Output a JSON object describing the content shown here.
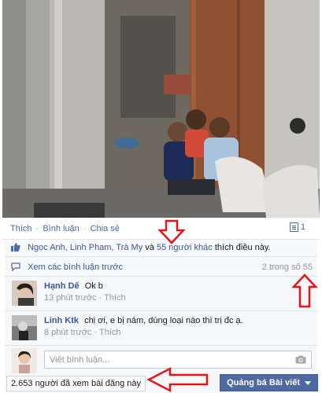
{
  "post": {
    "photo_alt": "",
    "actions": {
      "like": "Thích",
      "comment": "Bình luận",
      "share": "Chia sẻ",
      "separator": "·"
    },
    "share_count": "1"
  },
  "likes": {
    "names": "Ngọc Anh, Linh Pham, Trà My",
    "and": "và",
    "others": "55 người khác",
    "suffix": "thích điều này."
  },
  "previous_comments": {
    "label": "Xem các bình luận trước",
    "pager": "2 trong số 55"
  },
  "comments": [
    {
      "author": "Hạnh Dế",
      "text": "Ok b",
      "time": "13 phút trước",
      "like": "Thích"
    },
    {
      "author": "Linh Ktk",
      "text": "chị ơi, e bị nám, dùng loại nào thì trị đc ạ.",
      "time": "8 phút trước",
      "like": "Thích"
    }
  ],
  "composer": {
    "placeholder": "Viết bình luận..."
  },
  "footer": {
    "views": "2.653 người đã xem bài đăng này",
    "promote": "Quảng bá Bài viết"
  },
  "colors": {
    "link": "#3b5998",
    "promote": "#4e69a2",
    "annotation": "#e3151a"
  }
}
